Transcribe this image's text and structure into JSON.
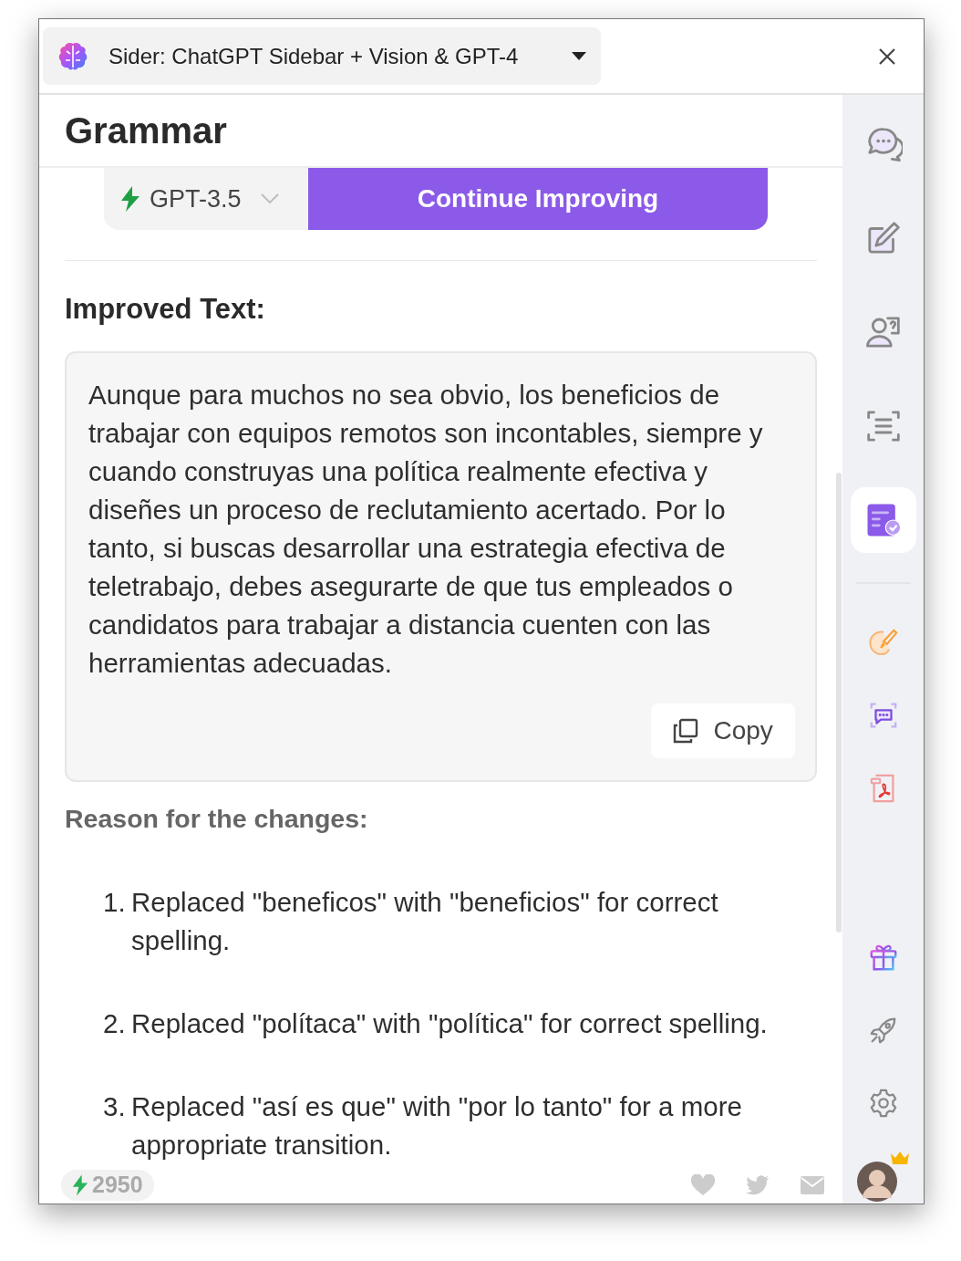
{
  "header": {
    "title": "Sider: ChatGPT Sidebar + Vision & GPT-4"
  },
  "page_title": "Grammar",
  "model_picker": {
    "model": "GPT-3.5"
  },
  "action_button": "Continue Improving",
  "improved": {
    "heading": "Improved Text:",
    "text": "Aunque para muchos no sea obvio, los beneficios de trabajar con equipos remotos son incontables, siempre y cuando construyas una política realmente efectiva y diseñes un proceso de reclutamiento acertado. Por lo tanto, si buscas desarrollar una estrategia efectiva de teletrabajo, debes asegurarte de que tus empleados o candidatos para trabajar a distancia cuenten con las herramientas adecuadas.",
    "copy_label": "Copy"
  },
  "reasons": {
    "heading": "Reason for the changes:",
    "items": [
      {
        "number": "1.",
        "text": "Replaced \"beneficos\" with \"beneficios\" for correct spelling."
      },
      {
        "number": "2.",
        "text": "Replaced \"polítaca\" with \"política\" for correct spelling."
      },
      {
        "number": "3.",
        "text": "Replaced \"así es que\" with \"por lo tanto\" for a more appropriate transition."
      }
    ]
  },
  "footer": {
    "credits": "2950"
  },
  "rail": {
    "top": [
      {
        "kind": "chat",
        "selected": false
      },
      {
        "kind": "write",
        "selected": false
      },
      {
        "kind": "ask",
        "selected": false
      },
      {
        "kind": "scan",
        "selected": false
      },
      {
        "kind": "grammar",
        "selected": true
      }
    ],
    "tools": [
      {
        "kind": "brush"
      },
      {
        "kind": "scan-chat"
      },
      {
        "kind": "pdf"
      }
    ],
    "bottom": [
      {
        "kind": "gift"
      },
      {
        "kind": "rocket"
      },
      {
        "kind": "settings"
      },
      {
        "kind": "avatar"
      }
    ]
  }
}
